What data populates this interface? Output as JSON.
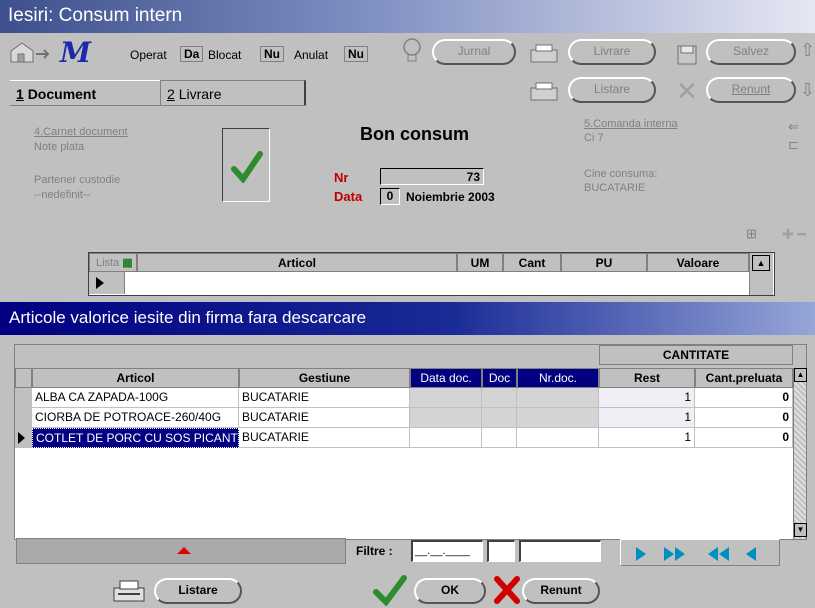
{
  "window": {
    "title": "Iesiri: Consum intern"
  },
  "toolbar": {
    "operat_label": "Operat",
    "operat_value": "Da",
    "blocat_label": "Blocat",
    "blocat_value": "Nu",
    "anulat_label": "Anulat",
    "anulat_value": "Nu",
    "jurnal": "Jurnal",
    "livrare": "Livrare",
    "salvez": "Salvez",
    "listare": "Listare",
    "renunt": "Renunt"
  },
  "tabs": [
    {
      "num": "1",
      "label": "Document"
    },
    {
      "num": "2",
      "label": "Livrare"
    }
  ],
  "document": {
    "carnet_label": "4.Carnet document",
    "note_plata": "Note plata",
    "partener_label": "Partener custodie",
    "partener_value": "--nedefinit--",
    "title": "Bon consum",
    "nr_label": "Nr",
    "nr_value": "73",
    "data_label": "Data",
    "data_day": "0",
    "data_value": "Noiembrie 2003",
    "comanda_label": "5.Comanda interna",
    "comanda_value": "Ci 7",
    "cine_label": "Cine consuma:",
    "cine_value": "BUCATARIE"
  },
  "top_grid": {
    "lista_label": "Lista",
    "columns": [
      "Articol",
      "UM",
      "Cant",
      "PU",
      "Valoare"
    ]
  },
  "dialog": {
    "title": "Articole valorice iesite din firma fara descarcare",
    "group_header": "CANTITATE",
    "columns": [
      "Articol",
      "Gestiune",
      "Data doc.",
      "Doc",
      "Nr.doc.",
      "Rest",
      "Cant.preluata"
    ],
    "rows": [
      {
        "articol": "ALBA CA ZAPADA-100G",
        "gestiune": "BUCATARIE",
        "data_doc": "",
        "doc": "",
        "nr_doc": "",
        "rest": "1",
        "cant": "0"
      },
      {
        "articol": "CIORBA DE POTROACE-260/40G",
        "gestiune": "BUCATARIE",
        "data_doc": "",
        "doc": "",
        "nr_doc": "",
        "rest": "1",
        "cant": "0"
      },
      {
        "articol": "COTLET DE PORC CU SOS PICANT",
        "gestiune": "BUCATARIE",
        "data_doc": "",
        "doc": "",
        "nr_doc": "",
        "rest": "1",
        "cant": "0"
      }
    ],
    "filtre_label": "Filtre :",
    "filtre_date": "__.__.____",
    "buttons": {
      "listare": "Listare",
      "ok": "OK",
      "renunt": "Renunt"
    }
  }
}
